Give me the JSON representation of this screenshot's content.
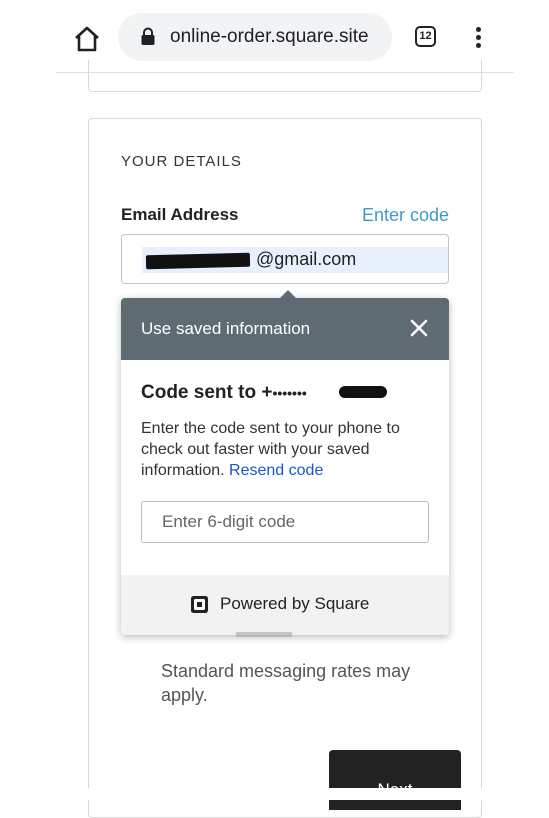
{
  "browser": {
    "url": "online-order.square.site",
    "tab_count": "12"
  },
  "details": {
    "heading": "YOUR DETAILS",
    "email_label": "Email Address",
    "enter_code_link": "Enter code",
    "email_value": "@gmail.com"
  },
  "popup": {
    "title": "Use saved information",
    "code_sent_prefix": "Code sent to +",
    "code_sent_masked": "•••••••",
    "instructions": "Enter the code sent to your phone to check out faster with your saved information.",
    "resend_link": "Resend code",
    "code_placeholder": "Enter 6-digit code",
    "powered_by": "Powered by Square"
  },
  "footer_note": "Standard messaging rates may apply.",
  "next_button": "Next",
  "colors": {
    "link_blue": "#3d9bc8",
    "resend_blue": "#1a55d0",
    "popup_header": "#5f6b73",
    "button_dark": "#222222",
    "autofill_bg": "#e8f0fe"
  }
}
